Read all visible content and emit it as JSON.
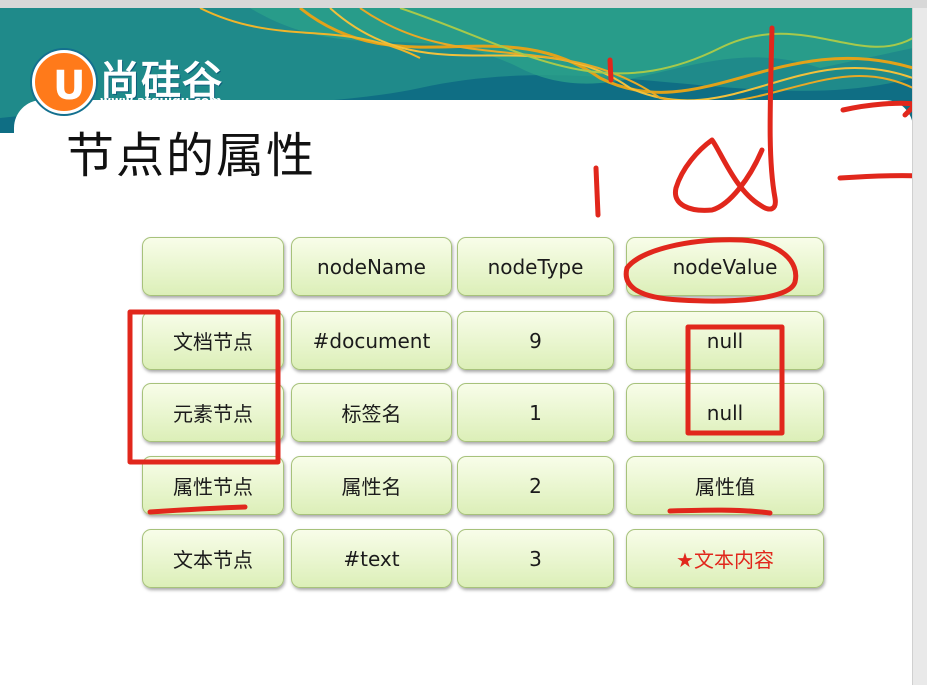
{
  "logo": {
    "text": "尚硅谷",
    "url": "www.atguigu.com",
    "letter": "U"
  },
  "slide": {
    "title": "节点的属性"
  },
  "table": {
    "header": [
      "",
      "nodeName",
      "nodeType",
      "nodeValue"
    ],
    "rows": [
      [
        "文档节点",
        "#document",
        "9",
        "null"
      ],
      [
        "元素节点",
        "标签名",
        "1",
        "null"
      ],
      [
        "属性节点",
        "属性名",
        "2",
        "属性值"
      ],
      [
        "文本节点",
        "#text",
        "3",
        "★文本内容"
      ]
    ]
  },
  "colors": {
    "accent_teal": "#13708f",
    "logo_orange": "#ff7a1a",
    "cell_green": "#dcefb8",
    "annotation_red": "#e1271c"
  }
}
